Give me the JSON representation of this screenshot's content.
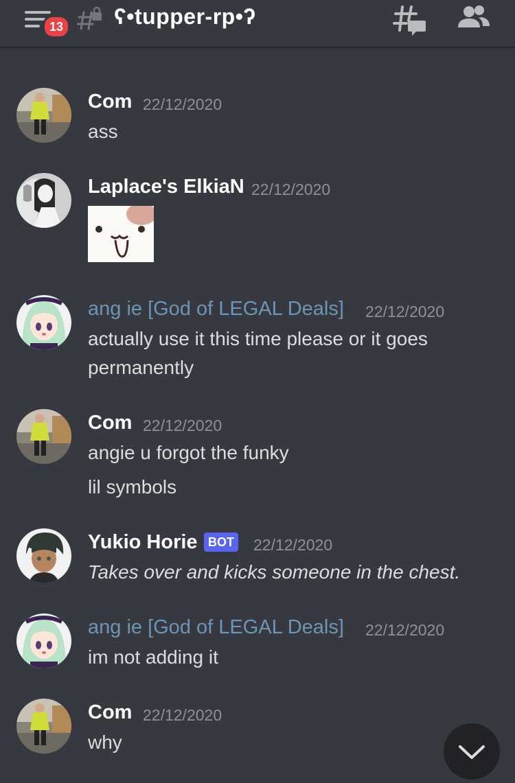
{
  "header": {
    "unread_count": "13",
    "channel_name": "ʕ•tupper-rp•ʔ",
    "icons": [
      "menu-icon",
      "locked-channel-icon",
      "threads-icon",
      "members-icon"
    ]
  },
  "messages": [
    {
      "author": "Com",
      "timestamp": "22/12/2020",
      "lines": [
        "ass"
      ]
    },
    {
      "author": "Laplace's ElkiaN",
      "timestamp": "22/12/2020",
      "lines": []
    },
    {
      "author": "ang ie [God of LEGAL Deals]",
      "timestamp": "22/12/2020",
      "lines": [
        "actually use it this time please or it goes",
        "permanently"
      ]
    },
    {
      "author": "Com",
      "timestamp": "22/12/2020",
      "lines": [
        "angie u forgot the funky",
        "lil symbols"
      ]
    },
    {
      "author": "Yukio Horie",
      "tag": "BOT",
      "timestamp": "22/12/2020",
      "lines": [
        "Takes over and kicks someone in the chest."
      ]
    },
    {
      "author": "ang ie [God of LEGAL Deals]",
      "timestamp": "22/12/2020",
      "lines": [
        "im not adding it"
      ]
    },
    {
      "author": "Com",
      "timestamp": "22/12/2020",
      "lines": [
        "why"
      ]
    }
  ],
  "colors": {
    "background": "#36393f",
    "role_name": "#6d95b5",
    "bot_tag": "#5865f2",
    "badge": "#ed4245"
  }
}
